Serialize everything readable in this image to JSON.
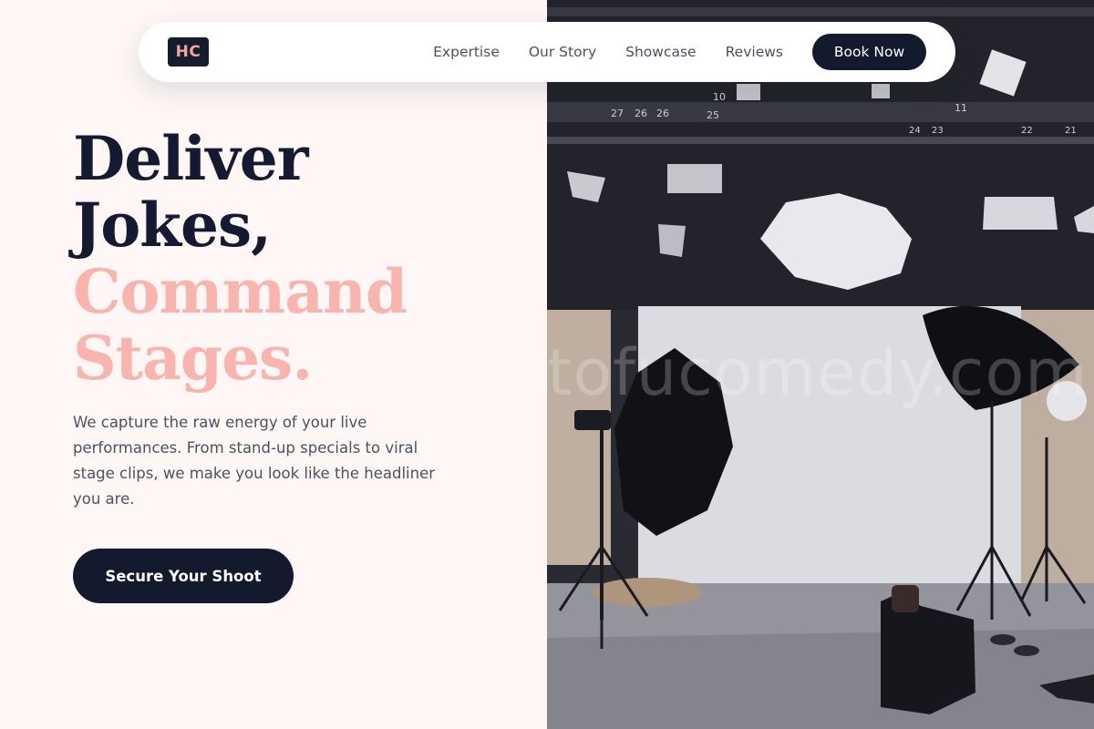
{
  "nav": {
    "logo_text": "HC",
    "links": [
      "Expertise",
      "Our Story",
      "Showcase",
      "Reviews"
    ],
    "cta_label": "Book Now"
  },
  "hero": {
    "headline_line1": "Deliver",
    "headline_line2": "Jokes,",
    "headline_line3": "Command",
    "headline_line4": "Stages.",
    "description": "We capture the raw energy of your live performances. From stand-up specials to viral stage clips, we make you look like the headliner you are.",
    "cta_label": "Secure Your Shoot"
  },
  "photo": {
    "subject": "photo-studio-with-lights",
    "watermark": "tofucomedy.com",
    "rig_numbers": [
      "27",
      "26",
      "26",
      "25",
      "10",
      "11",
      "24",
      "23",
      "22",
      "21"
    ]
  },
  "colors": {
    "background": "#fef7f6",
    "navy": "#131a2e",
    "pink": "#f8b4ad",
    "body_text": "#4b5160"
  }
}
